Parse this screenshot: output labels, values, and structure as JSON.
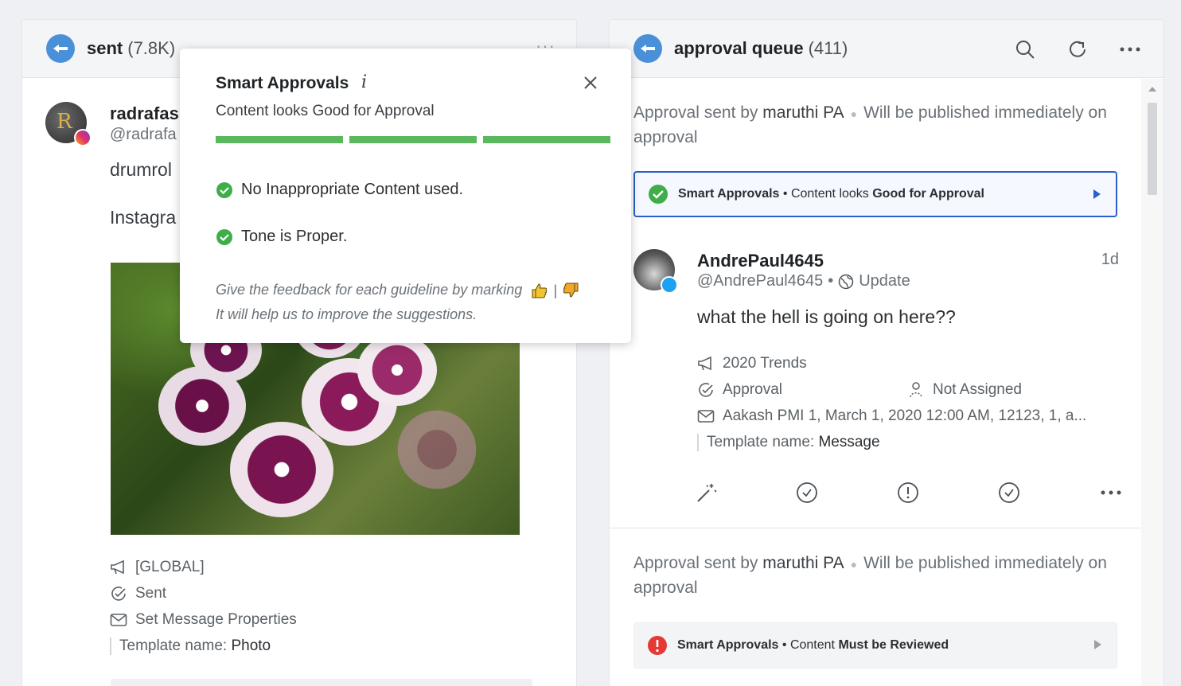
{
  "left": {
    "title": "sent",
    "count": "(7.8K)",
    "post": {
      "name": "radrafas",
      "handle": "@radrafa",
      "text1": "drumrol",
      "text2": "Instagra",
      "meta": [
        {
          "icon": "megaphone-icon",
          "text": "[GLOBAL]"
        },
        {
          "icon": "status-check-icon",
          "text": "Sent"
        },
        {
          "icon": "envelope-icon",
          "text": "Set Message Properties"
        }
      ],
      "template_label": "Template name:",
      "template_value": "Photo"
    }
  },
  "right": {
    "title": "approval queue",
    "count": "(411)",
    "items": [
      {
        "approval_prefix": "Approval sent by",
        "approver": "maruthi PA",
        "publish_note": "Will be published immediately on approval",
        "smart": {
          "label": "Smart Approvals",
          "sep": " • ",
          "pre": "Content looks ",
          "strong": "Good for Approval",
          "status": "good",
          "color": "#3fae49"
        },
        "author": "AndrePaul4645",
        "handle": "@AndrePaul4645",
        "handle_sep": "•",
        "type": "Update",
        "time": "1d",
        "message": "what the hell is going on here??",
        "campaign": "2020 Trends",
        "status": "Approval",
        "assignee": "Not Assigned",
        "properties": "Aakash PMI 1, March 1, 2020 12:00 AM, 12123, 1, a...",
        "template_label": "Template name:",
        "template_value": "Message"
      },
      {
        "approval_prefix": "Approval sent by",
        "approver": "maruthi PA",
        "publish_note": "Will be published immediately on approval",
        "smart": {
          "label": "Smart Approvals",
          "sep": " • ",
          "pre": "Content ",
          "strong": "Must be Reviewed",
          "status": "review",
          "color": "#e53935"
        }
      }
    ]
  },
  "popover": {
    "title": "Smart Approvals",
    "info_glyph": "i",
    "subtitle": "Content looks Good for Approval",
    "bar_color": "#5cb85c",
    "checks": [
      "No Inappropriate Content used.",
      "Tone is Proper."
    ],
    "feedback_line1": "Give the feedback for each guideline by marking",
    "feedback_sep": "|",
    "feedback_line2": "It will help us to improve the suggestions."
  },
  "colors": {
    "accent": "#2c5fc7",
    "brand": "#4a90d9",
    "success": "#3fae49",
    "danger": "#e53935"
  }
}
